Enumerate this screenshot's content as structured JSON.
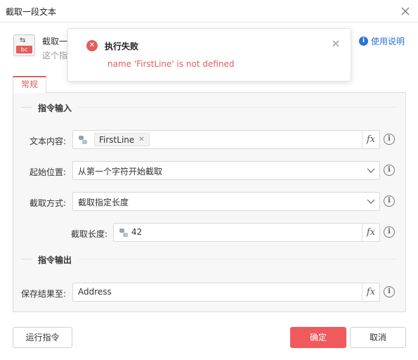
{
  "window": {
    "title": "截取一段文本"
  },
  "command": {
    "name": "截取一",
    "desc": "这个指",
    "icon_badge": "bc"
  },
  "help": {
    "label": "使用说明"
  },
  "toast": {
    "title": "执行失败",
    "message": "name 'FirstLine' is not defined"
  },
  "tabs": [
    {
      "label": "常规"
    }
  ],
  "sections": {
    "input": "指令输入",
    "output": "指令输出"
  },
  "fields": {
    "text_content": {
      "label": "文本内容:",
      "chip": "FirstLine"
    },
    "start_pos": {
      "label": "起始位置:",
      "value": "从第一个字符开始截取"
    },
    "mode": {
      "label": "截取方式:",
      "value": "截取指定长度"
    },
    "length": {
      "label": "截取长度:",
      "value": "42"
    },
    "save_to": {
      "label": "保存结果至:",
      "value": "Address"
    }
  },
  "fx_label": "fx",
  "info_label": "i",
  "buttons": {
    "run": "运行指令",
    "ok": "确定",
    "cancel": "取消"
  },
  "colors": {
    "accent": "#e35d5b",
    "primary_button": "#f05a5c",
    "link": "#2b73d6"
  }
}
